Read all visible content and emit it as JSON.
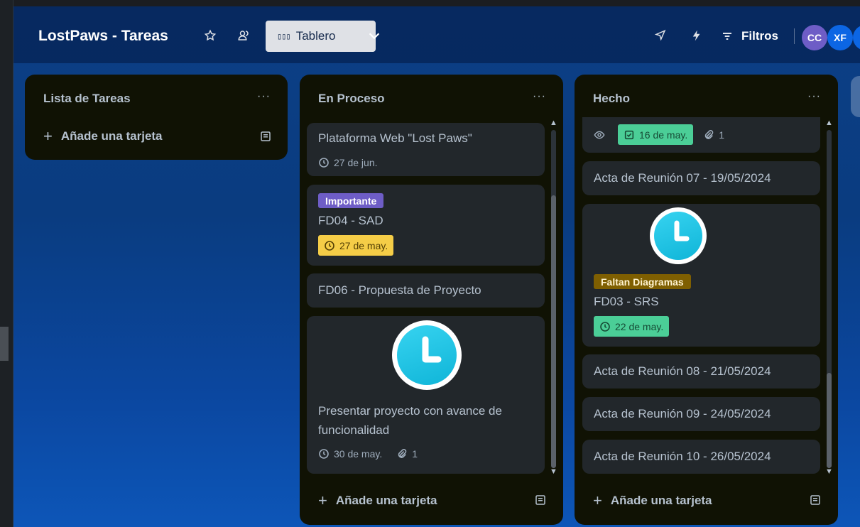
{
  "board": {
    "title": "LostPaws - Tareas",
    "view_label": "Tablero",
    "filters_label": "Filtros",
    "avatars": [
      {
        "initials": "CC",
        "color": "#6e5dc6"
      },
      {
        "initials": "XF",
        "color": "#0c66e4"
      },
      {
        "initials": "I",
        "color": "#0c66e4"
      }
    ],
    "icons": [
      "star-icon",
      "people-icon",
      "board-view-icon",
      "chevron-down-icon",
      "rocket-icon",
      "bolt-icon",
      "filter-icon"
    ]
  },
  "lists": [
    {
      "title": "Lista de Tareas",
      "menu": "···",
      "add_card": "Añade una tarjeta",
      "cards": []
    },
    {
      "title": "En Proceso",
      "menu": "···",
      "add_card": "Añade una tarjeta",
      "cards": [
        {
          "title": "Plataforma Web \"Lost Paws\"",
          "date": "27 de jun."
        },
        {
          "label": "Importante",
          "label_color": "#6e5dc6",
          "title": "FD04 - SAD",
          "date": "27 de may.",
          "date_color": "#f5cd47"
        },
        {
          "title": "FD06 - Propuesta de Proyecto"
        },
        {
          "cover": "clock",
          "title": "Presentar proyecto con avance de funcionalidad",
          "date": "30 de may.",
          "attachments": "1"
        }
      ]
    },
    {
      "title": "Hecho",
      "menu": "···",
      "add_card": "Añade una tarjeta",
      "cards": [
        {
          "watch": true,
          "date": "16 de may.",
          "date_color": "#4bce97",
          "attachments": "1"
        },
        {
          "title": "Acta de Reunión 07 - 19/05/2024"
        },
        {
          "cover": "clock",
          "label": "Faltan Diagramas",
          "label_color": "#7f5f01",
          "title": "FD03 - SRS",
          "date": "22 de may.",
          "date_color": "#4bce97"
        },
        {
          "title": "Acta de Reunión 08 - 21/05/2024"
        },
        {
          "title": "Acta de Reunión 09 - 24/05/2024"
        },
        {
          "title": "Acta de Reunión 10 - 26/05/2024"
        }
      ]
    }
  ]
}
